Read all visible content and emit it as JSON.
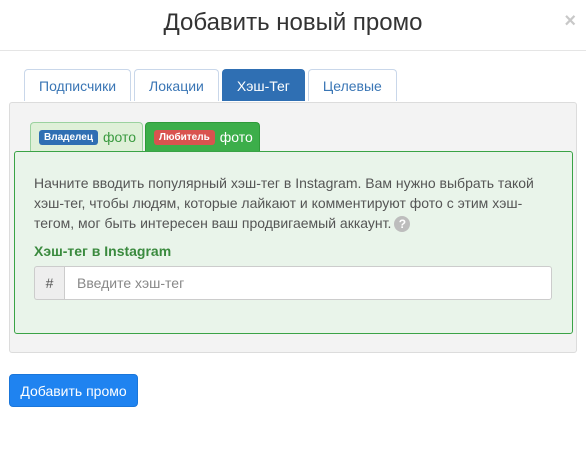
{
  "modal": {
    "title": "Добавить новый промо",
    "close_symbol": "×"
  },
  "main_tabs": [
    {
      "label": "Подписчики",
      "active": false
    },
    {
      "label": "Локации",
      "active": false
    },
    {
      "label": "Хэш-Тег",
      "active": true
    },
    {
      "label": "Целевые",
      "active": false
    }
  ],
  "sub_tabs": [
    {
      "badge": "Владелец",
      "label": "фото",
      "active": false,
      "badge_color": "#2f6fb3"
    },
    {
      "badge": "Любитель",
      "label": "фото",
      "active": true,
      "badge_color": "#d9534f"
    }
  ],
  "hashtag_panel": {
    "description": "Начните вводить популярный хэш-тег в Instagram. Вам нужно выбрать такой хэш-тег, чтобы людям, которые лайкают и комментируют фото с этим хэш-тегом, мог быть интересен ваш продвигаемый аккаунт.",
    "help_icon": "?",
    "field_label": "Хэш-тег в Instagram",
    "addon": "#",
    "input_value": "",
    "input_placeholder": "Введите хэш-тег"
  },
  "submit_label": "Добавить промо",
  "colors": {
    "primary": "#1f83f0",
    "tab_active": "#2f6fb3",
    "success": "#3cae4a",
    "success_text": "#3a8a3e"
  }
}
